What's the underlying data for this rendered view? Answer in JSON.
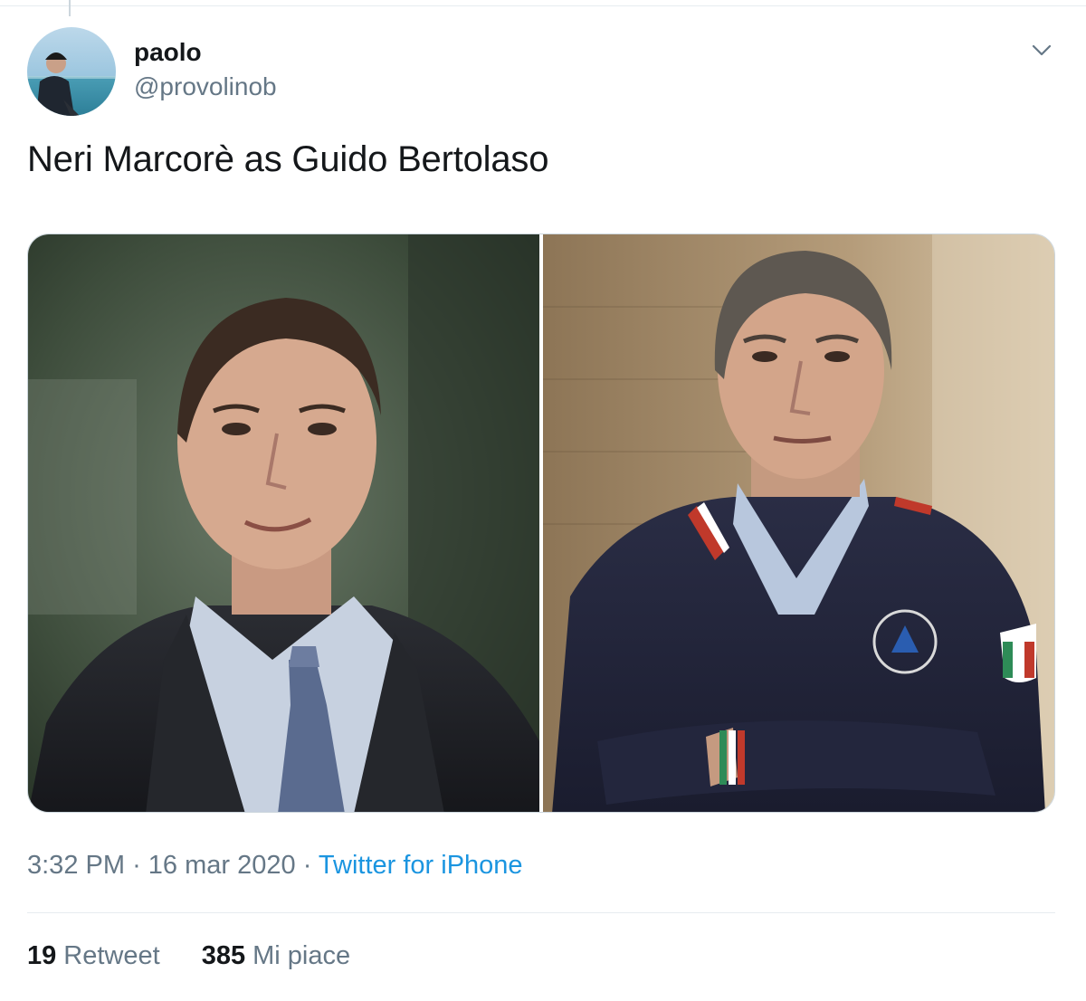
{
  "author": {
    "display_name": "paolo",
    "handle": "@provolinob",
    "avatar_icon": "avatar-photo"
  },
  "tweet": {
    "text": "Neri Marcorè as Guido Bertolaso",
    "media": [
      {
        "name": "photo-man-in-suit"
      },
      {
        "name": "photo-man-in-protezione-civile-jacket"
      }
    ]
  },
  "meta": {
    "time": "3:32 PM",
    "separator": "·",
    "date": "16 mar 2020",
    "source": "Twitter for iPhone"
  },
  "stats": {
    "retweets_count": "19",
    "retweets_label": "Retweet",
    "likes_count": "385",
    "likes_label": "Mi piace"
  },
  "colors": {
    "text": "#14171a",
    "secondary": "#657786",
    "link": "#1b95e0",
    "divider": "#e6ecf0"
  },
  "icons": {
    "caret": "chevron-down-icon"
  }
}
